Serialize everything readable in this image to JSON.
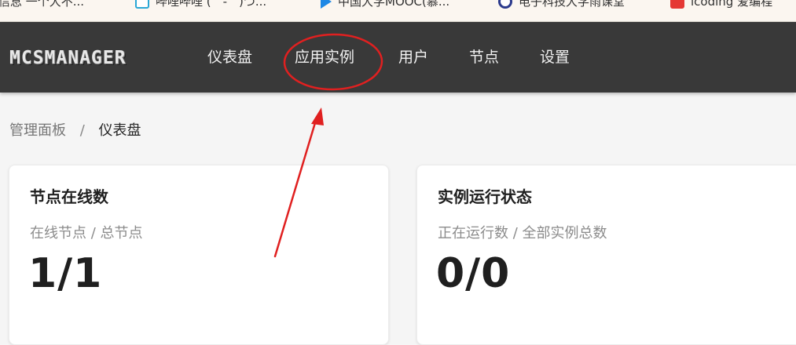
{
  "bookmarks": [
    {
      "label": "信息 一个大不...",
      "icon": "bookmark-icon"
    },
    {
      "label": "哔哩哔哩 (゜-゜)つ...",
      "icon": "bilibili-icon"
    },
    {
      "label": "中国大学MOOC(慕...",
      "icon": "mooc-icon"
    },
    {
      "label": "电子科技大学雨课堂",
      "icon": "university-icon"
    },
    {
      "label": "icoding 爱编程",
      "icon": "icoding-icon"
    }
  ],
  "header": {
    "logo_text": "MCSMANAGER",
    "nav": [
      {
        "label": "仪表盘"
      },
      {
        "label": "应用实例"
      },
      {
        "label": "用户"
      },
      {
        "label": "节点"
      },
      {
        "label": "设置"
      }
    ]
  },
  "breadcrumb": {
    "root": "管理面板",
    "separator": "/",
    "current": "仪表盘"
  },
  "cards": [
    {
      "title": "节点在线数",
      "subtitle": "在线节点 / 总节点",
      "value": "1/1"
    },
    {
      "title": "实例运行状态",
      "subtitle": "正在运行数 / 全部实例总数",
      "value": "0/0"
    }
  ],
  "colors": {
    "nav_bg": "#393939",
    "annotation_red": "#e02020"
  }
}
